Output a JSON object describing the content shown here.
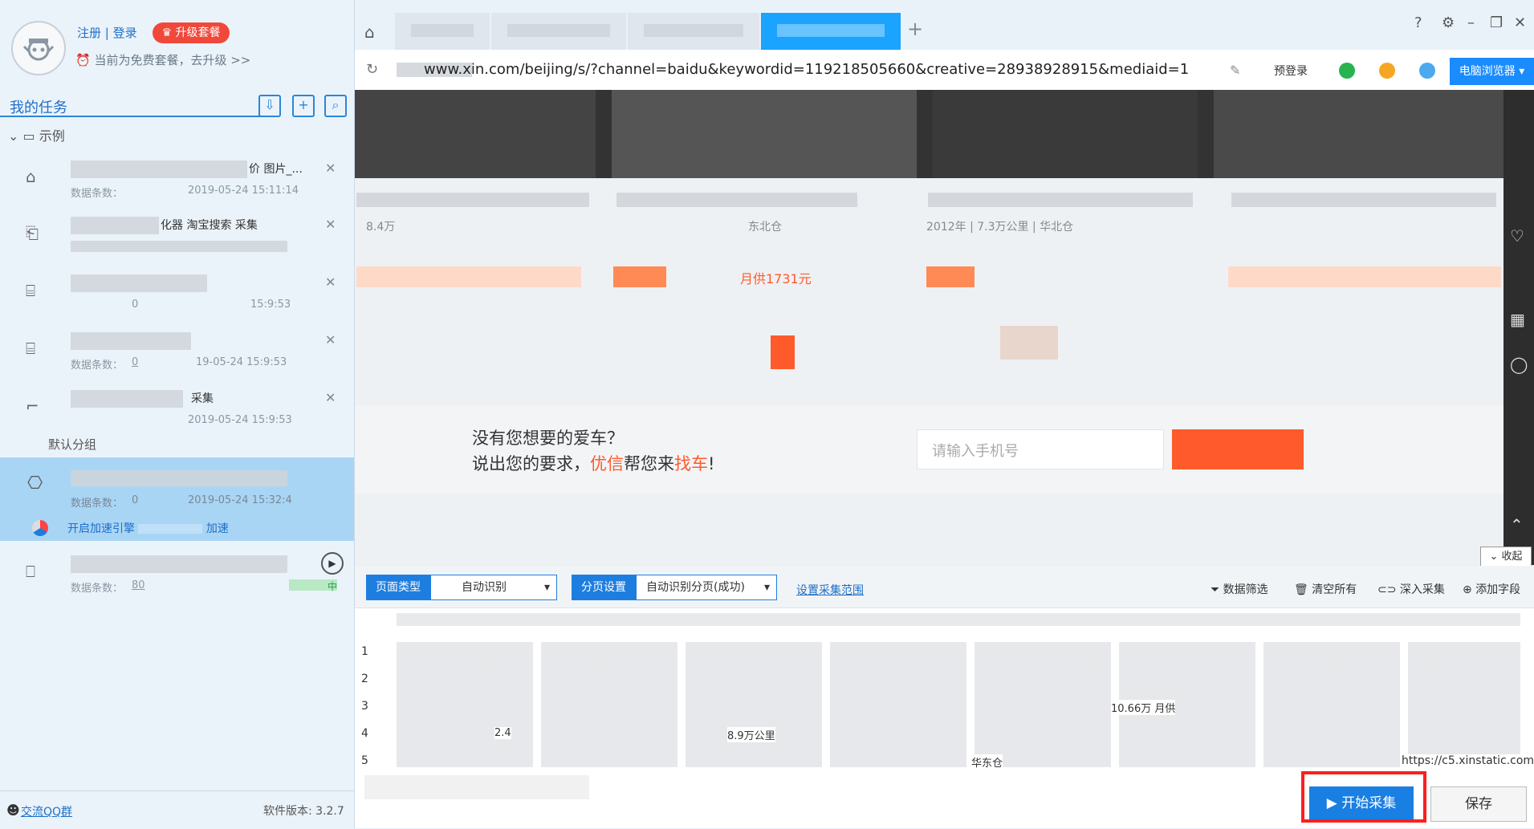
{
  "account": {
    "register": "注册",
    "separator": "|",
    "login": "登录",
    "upgrade": "升级套餐",
    "plan_text": "当前为免费套餐，去升级 >>"
  },
  "tasks": {
    "title": "我的任务",
    "group1": "示例",
    "group2": "默认分组",
    "items": [
      {
        "name_suffix": "价 图片_...",
        "count_label": "数据条数：",
        "count": "",
        "date": "2019-05-24 15:11:14"
      },
      {
        "name_suffix": "化器 淘宝搜索 采集",
        "count_label": "",
        "count": "",
        "date": ""
      },
      {
        "name_suffix": "",
        "count_label": "",
        "count": "0",
        "date": "15:9:53"
      },
      {
        "name_suffix": "",
        "count_label": "数据条数：",
        "count": "0",
        "date": "19-05-24 15:9:53"
      },
      {
        "name_suffix": "采集",
        "count_label": "",
        "count": "",
        "date": "2019-05-24 15:9:53"
      },
      {
        "name_suffix": "",
        "count_label": "数据条数：",
        "count": "0",
        "date": "2019-05-24 15:32:4"
      },
      {
        "name_suffix": "中",
        "count_label": "数据条数：",
        "count": "80",
        "date": ""
      }
    ],
    "accel_text": "开启加速引擎",
    "accel_suffix": "加速"
  },
  "footer": {
    "qq": "交流QQ群",
    "version": "软件版本: 3.2.7"
  },
  "browser": {
    "url": "www.xin.com/beijing/s/?channel=baidu&keywordid=119218505660&creative=28938928915&mediaid=1",
    "prelogin": "预登录",
    "pc_browser": "电脑浏览器"
  },
  "page": {
    "listing_1": "8.4万",
    "listing_2": "东北仓",
    "listing_3": "2012年 | 7.3万公里 | 华北仓",
    "price_text": "月供1731元",
    "find_line1": "没有您想要的爱车？",
    "find_line2_a": "说出您的要求，",
    "find_line2_b": "优信",
    "find_line2_c": "帮您来",
    "find_line2_d": "找车",
    "find_line2_e": "!",
    "phone_placeholder": "请输入手机号",
    "collapse": "收起"
  },
  "toolbar": {
    "page_type_label": "页面类型",
    "page_type_value": "自动识别",
    "paging_label": "分页设置",
    "paging_value": "自动识别分页(成功)",
    "range": "设置采集范围",
    "filter": "数据筛选",
    "clear": "清空所有",
    "deep": "深入采集",
    "add_field": "添加字段"
  },
  "table": {
    "rows": [
      "1",
      "2",
      "3",
      "4",
      "5"
    ],
    "cells": [
      "2.4",
      "8.9万公里",
      "10.66万 月供",
      "华东仓",
      "https://c5.xinstatic.com..."
    ]
  },
  "actions": {
    "start": "开始采集",
    "save": "保存"
  },
  "colors": {
    "accent": "#1e7ee0",
    "upgrade": "#f0483b",
    "highlight": "#ff1e1e",
    "orange": "#ff5a2c"
  }
}
